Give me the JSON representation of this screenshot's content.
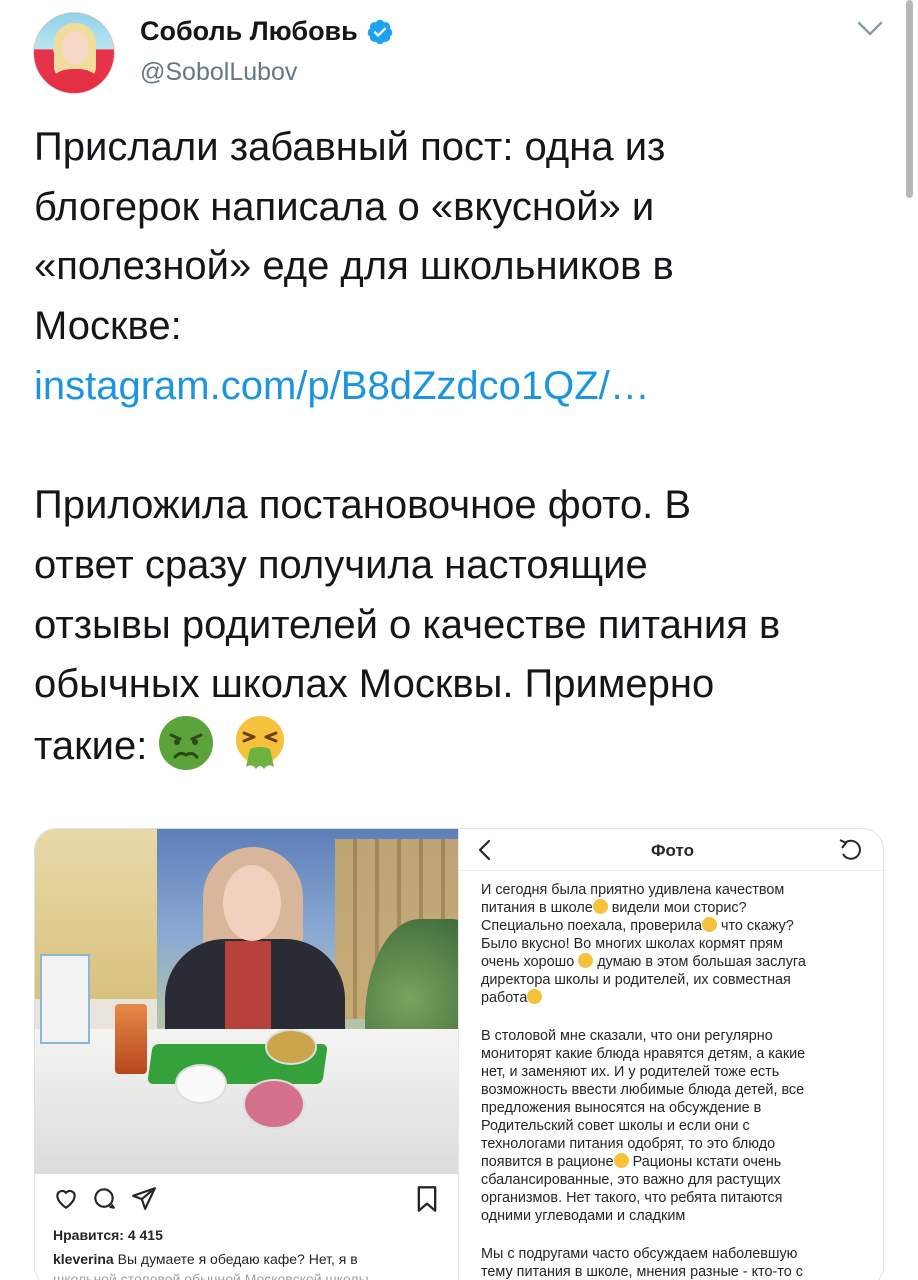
{
  "tweet": {
    "author": {
      "display_name": "Соболь Любовь",
      "handle": "@SobolLubov",
      "verified": true
    },
    "text_lines": [
      "Прислали забавный пост: одна из",
      "блогерок написала о «вкусной» и",
      "«полезной» еде для школьников в",
      "Москве:"
    ],
    "link": "instagram.com/p/B8dZzdco1QZ/…",
    "text_lines_2": [
      "Приложила постановочное фото. В",
      "ответ сразу получила настоящие",
      "отзывы родителей о качестве питания в",
      "обычных школах Москвы. Примерно"
    ],
    "last_line": "такие:",
    "emojis": [
      "nauseated-face-icon",
      "vomiting-face-icon"
    ]
  },
  "instagram_post": {
    "likes": "Нравится: 4 415",
    "caption_user": "kleverina",
    "caption_text": "Вы думаете я обедаю кафе? Нет, я в",
    "caption_cut": "школьной столовой обычной Московской школы"
  },
  "photo_screen": {
    "title": "Фото",
    "paragraph_1": [
      "И сегодня была приятно удивлена качеством",
      "питания в школе",
      "видели мои сторис?",
      "Специально поехала, проверила",
      "что скажу?",
      "Было вкусно! Во многих школах кормят прям",
      "очень хорошо",
      "думаю в этом большая заслуга",
      "директора школы и родителей, их совместная",
      "работа"
    ],
    "paragraph_2": [
      "В столовой мне сказали, что они регулярно",
      "мониторят какие блюда нравятся детям, а какие",
      "нет, и заменяют их. И у родителей тоже есть",
      "возможность ввести любимые блюда детей, все",
      "предложения выносятся на обсуждение в",
      "Родительский совет школы и если они с",
      "технологами питания одобрят, то это блюдо",
      "появится в рационе",
      "Рационы кстати очень",
      "сбалансированные, это важно для растущих",
      "организмов. Нет такого, что ребята питаются",
      "одними углеводами и сладким"
    ],
    "paragraph_3": [
      "Мы с подругами часто обсуждаем наболевшую",
      "тему питания в школе, мнения разные - кто-то с"
    ]
  },
  "colors": {
    "link": "#1b95e0",
    "verified": "#1da1f2",
    "secondary_text": "#657786"
  }
}
